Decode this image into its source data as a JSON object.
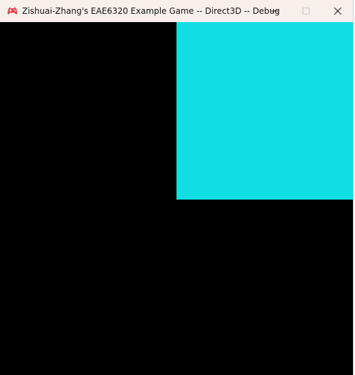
{
  "window": {
    "title": "Zishuai-Zhang's EAE6320 Example Game -- Direct3D -- Debug",
    "app_icon": "game-controller-icon",
    "controls": {
      "minimize_icon": "minimize-icon",
      "maximize_icon": "maximize-icon",
      "close_icon": "close-icon"
    }
  },
  "scene": {
    "background_color": "#000000",
    "shape": {
      "kind": "square",
      "color": "#0fdee2"
    }
  },
  "colors": {
    "titlebar": "#f6efec",
    "icon_red": "#e0444e"
  }
}
